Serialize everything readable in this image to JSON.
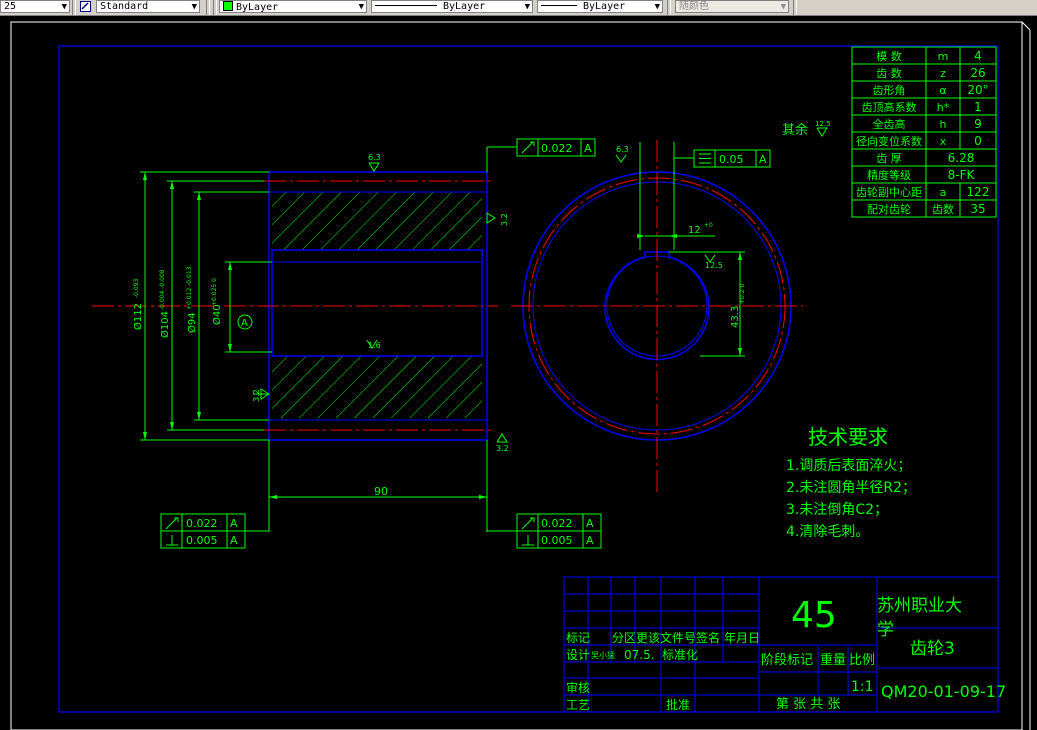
{
  "toolbar": {
    "style_partial": "25",
    "text_style": "Standard",
    "layer_color": "ByLayer",
    "linetype": "ByLayer",
    "lineweight": "ByLayer",
    "plot_style": "随颜色"
  },
  "colors": {
    "background": "#000000",
    "border": "#0000ff",
    "geometry": "#0000ff",
    "dimension": "#00ff00",
    "centerline": "#ff0000",
    "hatch": "#00ff00"
  },
  "dims": {
    "surface_top": "6.3",
    "tol_top_val": "0.022",
    "tol_top_datum": "A",
    "rough_right": "3.2",
    "rough_bore": "1.6",
    "datum_label": "A",
    "d112": "Ø112",
    "d112_tol": "-0.093",
    "d104": "Ø104",
    "d104_tol": "-0.004 -0.008",
    "d94": "Ø94",
    "d94_tol": "+0.012 -0.013",
    "d40": "Ø40",
    "d40_tol": "+0.025 0",
    "length": "90",
    "tol_bl1_val": "0.022",
    "tol_bl1_datum": "A",
    "tol_bl2_val": "0.005",
    "tol_bl2_datum": "A",
    "tol_br1_val": "0.022",
    "tol_br1_datum": "A",
    "tol_br2_val": "0.005",
    "tol_br2_datum": "A",
    "rough_bottom": "3.2",
    "rough_left": "3.2",
    "key_rough": "6.3",
    "sym_val": "0.05",
    "sym_datum": "A",
    "keyway": "12",
    "keyway_tol": "+0",
    "key_rough2": "12.5",
    "key_depth": "43.3",
    "key_depth_tol": "+0.2 0",
    "other_rough_label": "其余",
    "other_rough_val": "12.5"
  },
  "params": [
    {
      "name": "模  数",
      "sym": "m",
      "val": "4"
    },
    {
      "name": "齿  数",
      "sym": "z",
      "val": "26"
    },
    {
      "name": "齿形角",
      "sym": "α",
      "val": "20°"
    },
    {
      "name": "齿顶高系数",
      "sym": "h*",
      "val": "1"
    },
    {
      "name": "全齿高",
      "sym": "h",
      "val": "9"
    },
    {
      "name": "径向变位系数",
      "sym": "x",
      "val": "0"
    },
    {
      "name": "齿  厚",
      "sym": "",
      "val": "6.28"
    },
    {
      "name": "精度等级",
      "sym": "",
      "val": "8-FK"
    },
    {
      "name": "齿轮副中心距",
      "sym": "a",
      "val": "122"
    },
    {
      "name": "配对齿轮",
      "sym": "齿数",
      "val": "35"
    }
  ],
  "tech": {
    "title": "技术要求",
    "items": [
      "1.调质后表面淬火；",
      "2.未注圆角半径R2；",
      "3.未注倒角C2；",
      "4.清除毛刺。"
    ]
  },
  "title_block": {
    "material": "45",
    "school_line1": "苏州职业大",
    "school_line2": "学",
    "part_name": "齿轮3",
    "drawing_no": "QM20-01-09-17",
    "scale": "1:1",
    "h_mark": "标记",
    "h_zone": "分区",
    "h_doc": "更该文件号",
    "h_sign": "签名",
    "h_date": "年月日",
    "designer_label": "设计",
    "designer": "吴小猛",
    "design_date": "07.5.",
    "std": "标准化",
    "stage": "阶段标记",
    "weight": "重量",
    "ratio": "比例",
    "review": "审核",
    "craft": "工艺",
    "approve": "批准",
    "sheet": "第 张  共 张"
  }
}
